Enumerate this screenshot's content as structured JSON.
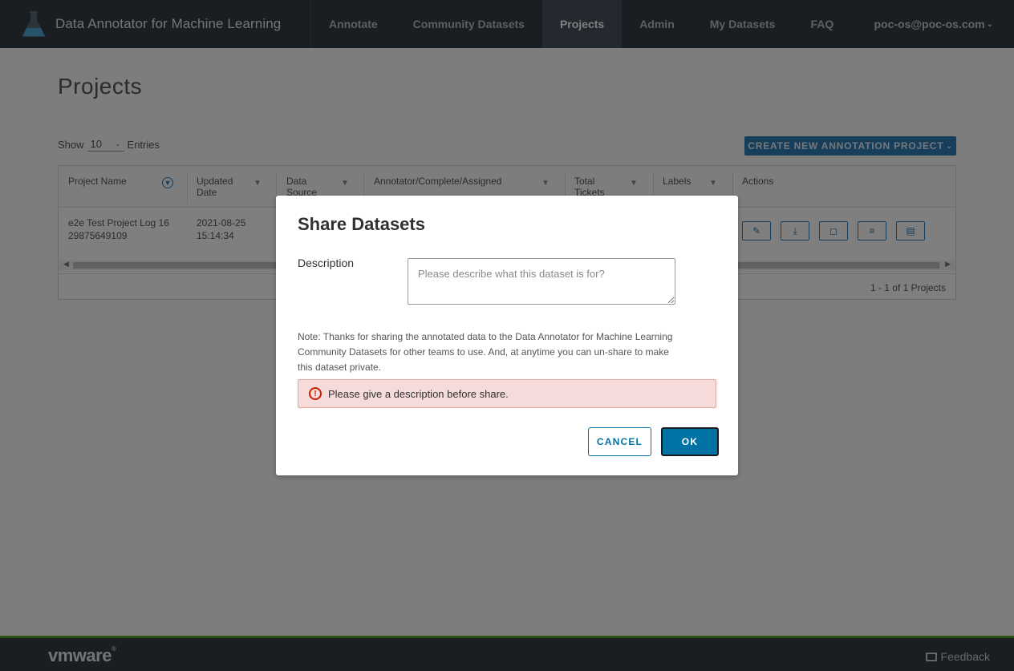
{
  "header": {
    "app_title": "Data Annotator for Machine Learning",
    "nav": [
      {
        "label": "Annotate"
      },
      {
        "label": "Community Datasets"
      },
      {
        "label": "Projects",
        "active": true
      },
      {
        "label": "Admin"
      },
      {
        "label": "My Datasets"
      },
      {
        "label": "FAQ"
      }
    ],
    "user": "poc-os@poc-os.com"
  },
  "page": {
    "title": "Projects",
    "show_label": "Show",
    "show_value": "10",
    "entries_label": "Entries",
    "create_button": "CREATE NEW ANNOTATION PROJECT"
  },
  "table": {
    "columns": {
      "project_name": "Project Name",
      "updated_date": "Updated Date",
      "data_source": "Data Source",
      "annotator": "Annotator/Complete/Assigned",
      "total_tickets": "Total Tickets",
      "labels": "Labels",
      "actions": "Actions"
    },
    "rows": [
      {
        "project_name": "e2e Test Project Log 16 29875649109",
        "updated_date": "2021-08-25 15:14:34"
      }
    ],
    "footer_count": "1 - 1 of 1 Projects"
  },
  "modal": {
    "title": "Share Datasets",
    "description_label": "Description",
    "description_value": "",
    "description_placeholder": "Please describe what this dataset is for?",
    "note": "Note: Thanks for sharing the annotated data to the Data Annotator for Machine Learning Community Datasets for other teams to use. And, at anytime you can un-share to make this dataset private.",
    "error": "Please give a description before share.",
    "cancel_label": "CANCEL",
    "ok_label": "OK"
  },
  "footer": {
    "logo": "vmware",
    "feedback": "Feedback"
  },
  "colors": {
    "header_bg": "#313c45",
    "primary": "#0072a3",
    "error": "#c92100",
    "error_bg": "#f5dbd9",
    "footer_accent": "#5aa220"
  },
  "icons": {
    "brand": "flask-icon",
    "filter": "filter-icon",
    "alert": "exclamation-circle-icon",
    "actions": [
      "edit-icon",
      "download-icon",
      "folder-icon",
      "share-icon",
      "trash-icon"
    ],
    "feedback": "chat-icon"
  }
}
